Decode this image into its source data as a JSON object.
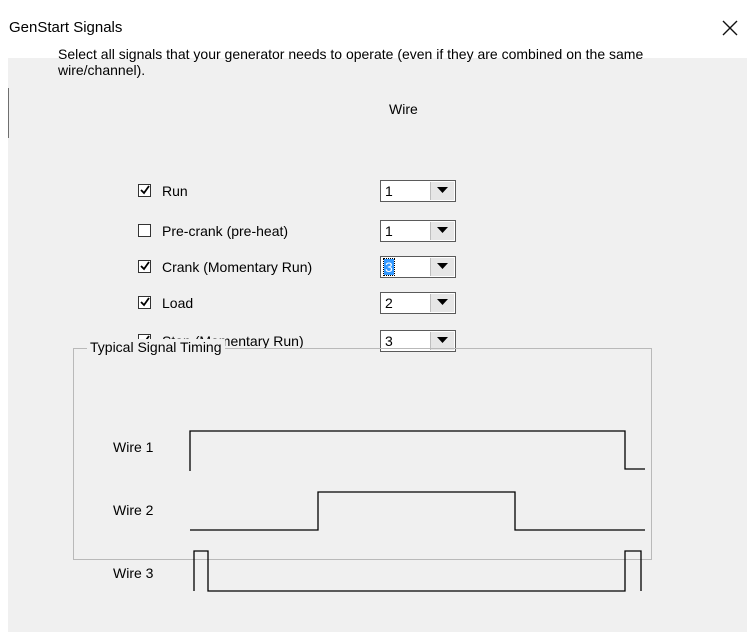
{
  "window": {
    "title": "GenStart Signals",
    "close_icon": "close-icon"
  },
  "instructions": "Select all signals that your generator needs to operate (even if they are combined on the same wire/channel).",
  "wire_column_header": "Wire",
  "signals": [
    {
      "label": "Run",
      "checked": true,
      "wire": "1",
      "selected": false
    },
    {
      "label": "Pre-crank (pre-heat)",
      "checked": false,
      "wire": "1",
      "selected": false
    },
    {
      "label": "Crank (Momentary Run)",
      "checked": true,
      "wire": "3",
      "selected": true
    },
    {
      "label": "Load",
      "checked": true,
      "wire": "2",
      "selected": false
    },
    {
      "label": "Stop (Momentary Run)",
      "checked": true,
      "wire": "3",
      "selected": false
    }
  ],
  "timing": {
    "title": "Typical Signal Timing",
    "wires": [
      "Wire 1",
      "Wire 2",
      "Wire 3"
    ]
  },
  "colors": {
    "dialog_bg": "#f0f0f0",
    "titlebar_bg": "#ffffff",
    "selection": "#3399ff"
  }
}
